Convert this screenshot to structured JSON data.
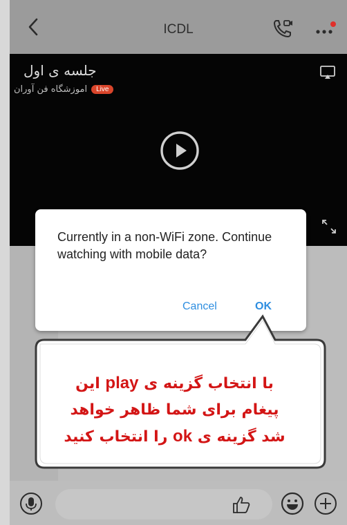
{
  "header": {
    "title": "ICDL",
    "icons": {
      "back": "chevron-left-icon",
      "call": "video-call-icon",
      "more": "more-dots-icon"
    },
    "notification_dot_color": "#e0302b"
  },
  "video": {
    "title": "جلسه ی اول",
    "channel": "اموزشگاه فن آوران",
    "live_label": "Live",
    "live_color": "#d9452b"
  },
  "dialog": {
    "message": "Currently in a non-WiFi zone. Continue watching with mobile data?",
    "cancel_label": "Cancel",
    "ok_label": "OK",
    "button_color": "#2e8ee0"
  },
  "callout": {
    "line1_prefix": "با انتخاب گزینه ی",
    "line1_keyword": "play",
    "line1_suffix": "این",
    "line2": "پیغام برای شما ظاهر خواهد",
    "line3_prefix": "شد گزینه ی",
    "line3_keyword": "ok",
    "line3_suffix": "را انتخاب کنید",
    "text_color": "#d31515"
  },
  "input_bar": {
    "placeholder": "",
    "icons": {
      "mic": "microphone-icon",
      "like": "thumbs-up-icon",
      "emoji": "smiley-icon",
      "add": "plus-circle-icon"
    }
  }
}
